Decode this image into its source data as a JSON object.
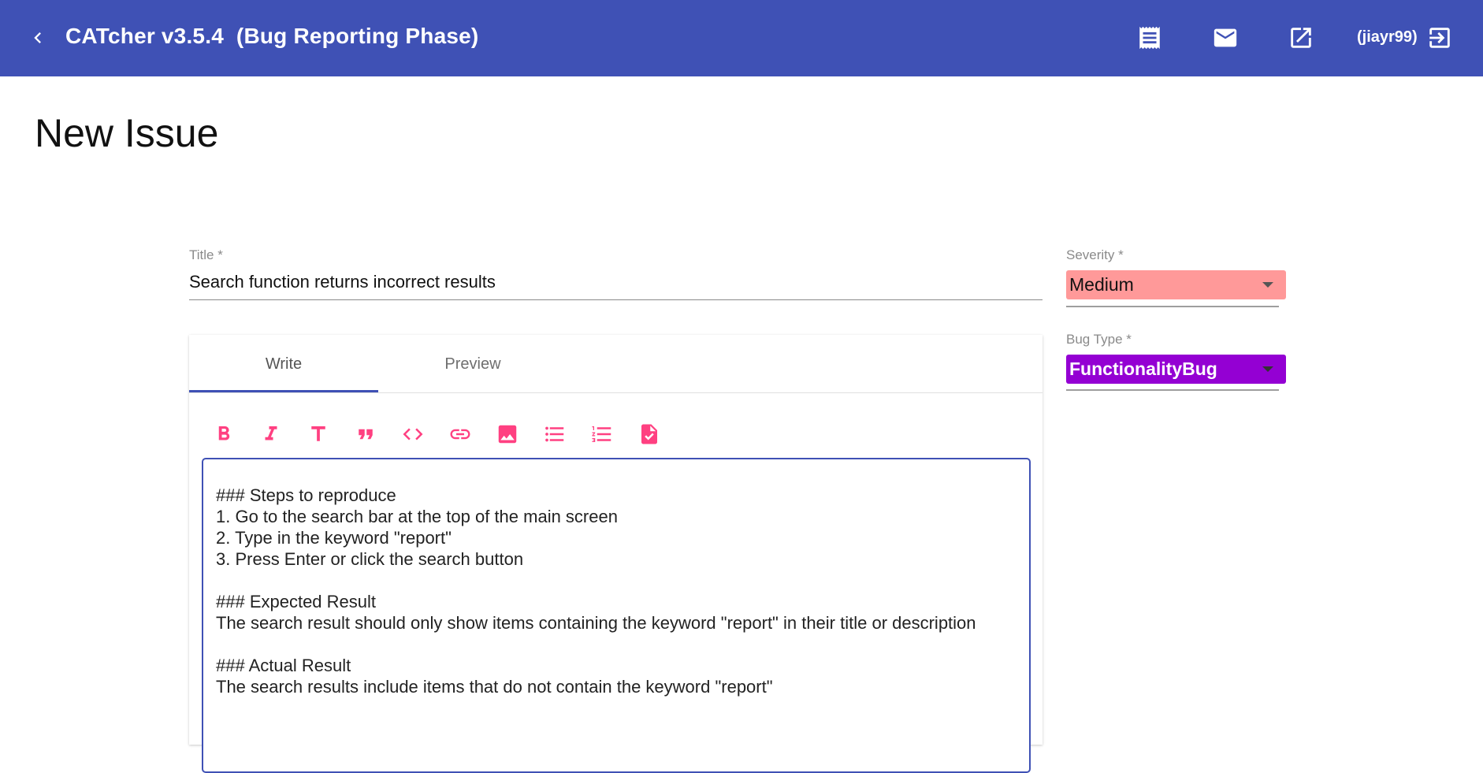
{
  "toolbar": {
    "app_title": "CATcher v3.5.4  (Bug Reporting Phase)",
    "user": "(jiayr99)",
    "background": "#3f51b5",
    "icons": [
      "back-arrow-icon",
      "receipt-icon",
      "mail-icon",
      "open-in-new-icon",
      "logout-icon"
    ]
  },
  "page": {
    "title": "New Issue"
  },
  "form": {
    "title_label": "Title *",
    "title_value": "Search function returns incorrect results",
    "severity": {
      "label": "Severity *",
      "value": "Medium",
      "color": "#ff9999"
    },
    "bug_type": {
      "label": "Bug Type *",
      "value": "FunctionalityBug",
      "color": "#9400d3"
    }
  },
  "editor": {
    "tabs": [
      {
        "label": "Write",
        "active": true
      },
      {
        "label": "Preview",
        "active": false
      }
    ],
    "format_buttons": [
      "bold-icon",
      "italic-icon",
      "header-icon",
      "quote-icon",
      "code-icon",
      "link-icon",
      "image-icon",
      "bulleted-list-icon",
      "numbered-list-icon",
      "task-list-icon"
    ],
    "accent": "#ff4081",
    "content": "### Steps to reproduce\n1. Go to the search bar at the top of the main screen\n2. Type in the keyword \"report\"\n3. Press Enter or click the search button\n\n### Expected Result\nThe search result should only show items containing the keyword \"report\" in their title or description\n\n### Actual Result\nThe search results include items that do not contain the keyword \"report\""
  }
}
